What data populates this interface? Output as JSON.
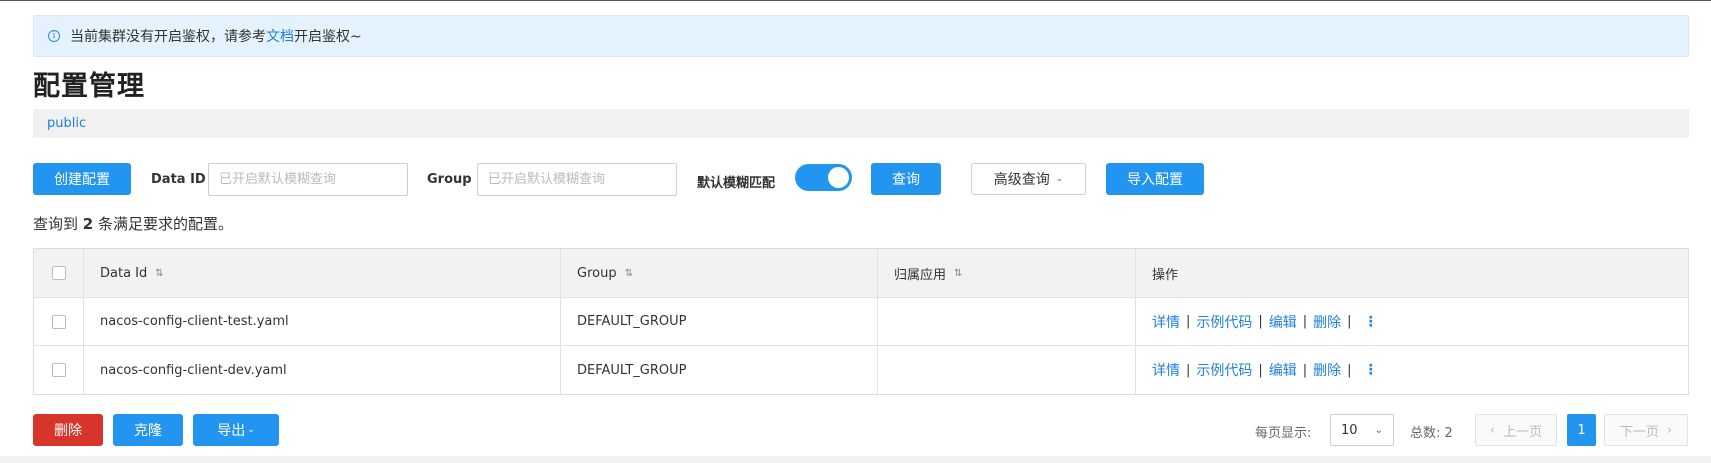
{
  "notice": {
    "text_before": "当前集群没有开启鉴权，请参考",
    "link": "文档",
    "text_after": "开启鉴权~"
  },
  "title": "配置管理",
  "namespace": "public",
  "toolbar": {
    "create_label": "创建配置",
    "dataid_label": "Data ID",
    "dataid_placeholder": "已开启默认模糊查询",
    "group_label": "Group",
    "group_placeholder": "已开启默认模糊查询",
    "fuzzy_label": "默认模糊匹配",
    "fuzzy_on": true,
    "search_label": "查询",
    "advanced_label": "高级查询",
    "import_label": "导入配置"
  },
  "result": {
    "prefix": "查询到",
    "count": "2",
    "suffix": "条满足要求的配置。"
  },
  "table": {
    "headers": [
      "Data Id",
      "Group",
      "归属应用",
      "操作"
    ],
    "rows": [
      {
        "data_id": "nacos-config-client-test.yaml",
        "group": "DEFAULT_GROUP",
        "app": ""
      },
      {
        "data_id": "nacos-config-client-dev.yaml",
        "group": "DEFAULT_GROUP",
        "app": ""
      }
    ],
    "actions": [
      "详情",
      "示例代码",
      "编辑",
      "删除"
    ]
  },
  "footer": {
    "delete_label": "删除",
    "clone_label": "克隆",
    "export_label": "导出"
  },
  "pagination": {
    "page_size_label": "每页显示:",
    "page_size": "10",
    "total_label": "总数:",
    "total": "2",
    "prev_label": "上一页",
    "next_label": "下一页",
    "current_page": "1"
  },
  "colors": {
    "primary": "#2295f0",
    "danger": "#d8352a",
    "link": "#1f7fe0",
    "notice_bg": "#e3f2fd"
  }
}
